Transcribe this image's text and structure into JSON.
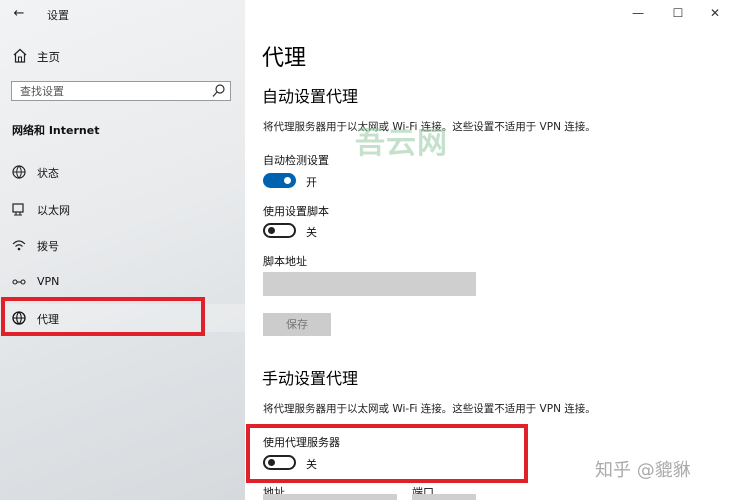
{
  "window": {
    "title": "设置",
    "controls": {
      "minimize": "—",
      "maximize": "☐",
      "close": "✕"
    }
  },
  "sidebar": {
    "back_icon": "back-arrow-icon",
    "home": {
      "label": "主页",
      "icon": "home-icon"
    },
    "search": {
      "placeholder": "查找设置",
      "icon": "search-icon"
    },
    "section": "网络和 Internet",
    "items": [
      {
        "label": "状态",
        "icon": "status-globe-icon",
        "selected": false
      },
      {
        "label": "以太网",
        "icon": "ethernet-icon",
        "selected": false
      },
      {
        "label": "拨号",
        "icon": "dialup-icon",
        "selected": false
      },
      {
        "label": "VPN",
        "icon": "vpn-icon",
        "selected": false
      },
      {
        "label": "代理",
        "icon": "globe-icon",
        "selected": true
      }
    ]
  },
  "main": {
    "title": "代理",
    "auto": {
      "heading": "自动设置代理",
      "description": "将代理服务器用于以太网或 Wi-Fi 连接。这些设置不适用于 VPN 连接。",
      "detect_label": "自动检测设置",
      "detect_state": "开",
      "script_label": "使用设置脚本",
      "script_state": "关",
      "address_label": "脚本地址",
      "address_value": "",
      "save_label": "保存"
    },
    "manual": {
      "heading": "手动设置代理",
      "description": "将代理服务器用于以太网或 Wi-Fi 连接。这些设置不适用于 VPN 连接。",
      "use_proxy_label": "使用代理服务器",
      "use_proxy_state": "关",
      "address_label": "地址",
      "port_label": "端口"
    },
    "watermarks": {
      "site": "吾云网",
      "zhihu": "知乎 @貔貅"
    }
  },
  "colors": {
    "accent": "#0063b1",
    "highlight_red": "#e0212c"
  }
}
